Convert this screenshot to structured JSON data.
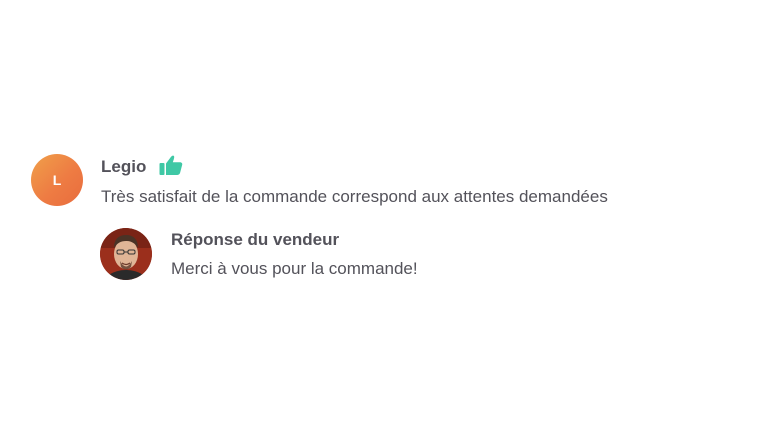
{
  "review": {
    "avatar_initial": "L",
    "reviewer_name": "Legio",
    "rating_icon": "thumbs-up-icon",
    "text": "Très satisfait de la commande correspond aux attentes demandées"
  },
  "seller_reply": {
    "avatar_icon": "seller-avatar-photo",
    "title": "Réponse du vendeur",
    "text": "Merci à vous pour la commande!"
  },
  "colors": {
    "text": "#53525a",
    "thumb": "#3fc8a5",
    "avatar_gradient_start": "#f0a04a",
    "avatar_gradient_end": "#e86c3e"
  }
}
